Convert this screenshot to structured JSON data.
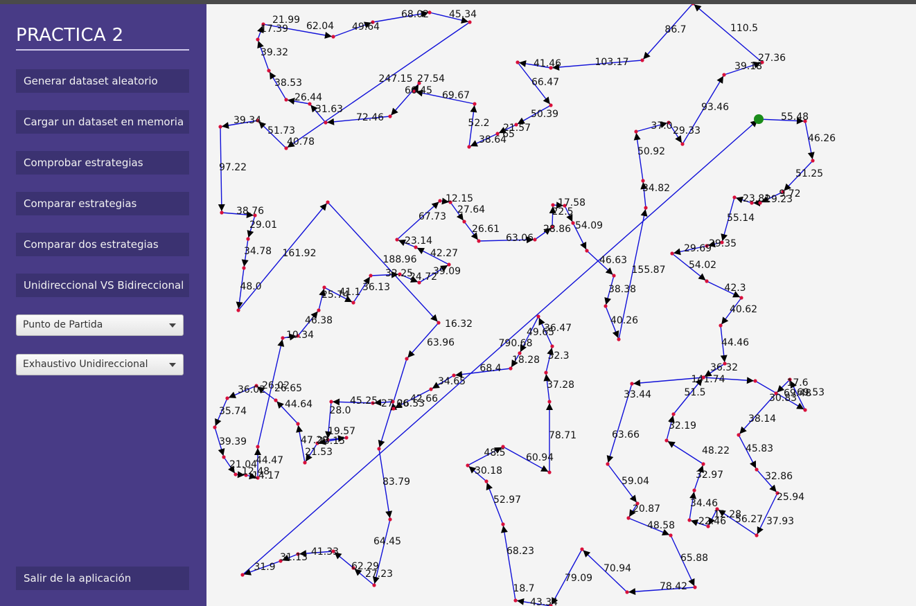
{
  "app": {
    "title": "PRACTICA 2"
  },
  "sidebar": {
    "buttons": [
      "Generar dataset aleatorio",
      "Cargar un dataset en memoria",
      "Comprobar estrategias",
      "Comparar estrategias",
      "Comparar dos estrategias",
      "Unidireccional VS Bidireccional"
    ],
    "start_point_select": "Punto de Partida",
    "strategy_select": "Exhaustivo Unidireccional",
    "exit_button": "Salir de la aplicación"
  },
  "graph": {
    "colors": {
      "edge": "#1010d8",
      "node": "#d8103a",
      "start": "#1a8c1a",
      "arrow": "#000000"
    },
    "edge_labels": [
      "21.99",
      "17.39",
      "62.04",
      "49.64",
      "68.02",
      "45.34",
      "86.7",
      "110.5",
      "27.36",
      "39.18",
      "39.32",
      "38.53",
      "26.44",
      "31.63",
      "41.46",
      "103.17",
      "66.47",
      "247.15",
      "27.54",
      "66.45",
      "69.67",
      "72.46",
      "93.46",
      "50.39",
      "39.34",
      "51.73",
      "40.78",
      "21.57",
      "52.2",
      "38.64",
      "65",
      "37.0",
      "29.33",
      "55.48",
      "46.26",
      "50.92",
      "97.22",
      "51.25",
      "34.82",
      "12.15",
      "17.58",
      "22.5",
      "27.64",
      "67.73",
      "26.61",
      "28.86",
      "23.81",
      "29.23",
      "9.72",
      "38.76",
      "29.01",
      "55.14",
      "54.09",
      "63.06",
      "23.14",
      "42.27",
      "34.78",
      "161.92",
      "29.69",
      "29.35",
      "188.96",
      "46.63",
      "54.02",
      "155.87",
      "32.25",
      "39.09",
      "24.72",
      "48.0",
      "25.74",
      "41.1",
      "36.13",
      "38.38",
      "42.3",
      "40.62",
      "40.26",
      "16.32",
      "46.38",
      "10.34",
      "36.47",
      "49.65",
      "790.68",
      "44.46",
      "63.96",
      "32.3",
      "18.28",
      "68.4",
      "36.32",
      "141.74",
      "34.65",
      "26.02",
      "36.02",
      "26.65",
      "42.66",
      "45.25",
      "27.06",
      "26.53",
      "37.28",
      "17.6",
      "69.48",
      "69.53",
      "30.83",
      "51.5",
      "33.44",
      "35.74",
      "44.64",
      "28.0",
      "38.14",
      "32.19",
      "63.66",
      "39.39",
      "19.57",
      "47.29",
      "23.15",
      "21.53",
      "78.71",
      "45.83",
      "48.5",
      "48.22",
      "44.47",
      "21.04",
      "12.48",
      "14.17",
      "60.94",
      "30.18",
      "32.97",
      "32.86",
      "59.04",
      "83.79",
      "52.97",
      "25.94",
      "34.46",
      "12.28",
      "56.27",
      "20.87",
      "22.46",
      "48.58",
      "37.93",
      "64.45",
      "68.23",
      "41.33",
      "31.13",
      "31.9",
      "65.88",
      "62.29",
      "27.23",
      "70.94",
      "79.09",
      "78.42",
      "18.7",
      "43.34"
    ]
  }
}
